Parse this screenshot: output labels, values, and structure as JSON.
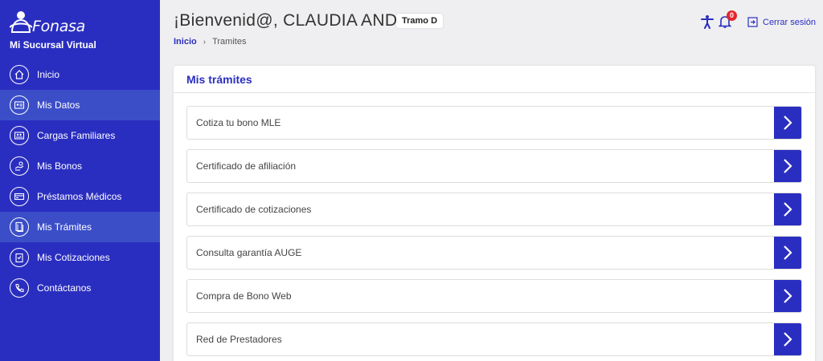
{
  "brand": {
    "name": "Fonasa",
    "subtitle": "Mi Sucursal Virtual"
  },
  "sidebar": {
    "items": [
      {
        "label": "Inicio",
        "icon": "home-icon",
        "active": false
      },
      {
        "label": "Mis Datos",
        "icon": "id-card-icon",
        "active": true
      },
      {
        "label": "Cargas Familiares",
        "icon": "family-card-icon",
        "active": false
      },
      {
        "label": "Mis Bonos",
        "icon": "hand-coin-icon",
        "active": false
      },
      {
        "label": "Préstamos Médicos",
        "icon": "medical-card-icon",
        "active": false
      },
      {
        "label": "Mis Trámites",
        "icon": "documents-icon",
        "active": true
      },
      {
        "label": "Mis Cotizaciones",
        "icon": "clipboard-icon",
        "active": false
      },
      {
        "label": "Contáctanos",
        "icon": "phone-icon",
        "active": false
      }
    ]
  },
  "header": {
    "welcome": "¡Bienvenid@, CLAUDIA ANDREA",
    "tramo": "Tramo D",
    "notifications_count": "0",
    "logout_label": "Cerrar sesión"
  },
  "breadcrumb": {
    "home": "Inicio",
    "current": "Tramites"
  },
  "main": {
    "title": "Mis trámites",
    "items": [
      {
        "label": "Cotiza tu bono MLE"
      },
      {
        "label": "Certificado de afiliación"
      },
      {
        "label": "Certificado de cotizaciones"
      },
      {
        "label": "Consulta garantía AUGE"
      },
      {
        "label": "Compra de Bono Web"
      },
      {
        "label": "Red de Prestadores"
      }
    ]
  },
  "colors": {
    "primary": "#2a2ec0",
    "badge": "#e3262c",
    "background": "#efeff1"
  }
}
